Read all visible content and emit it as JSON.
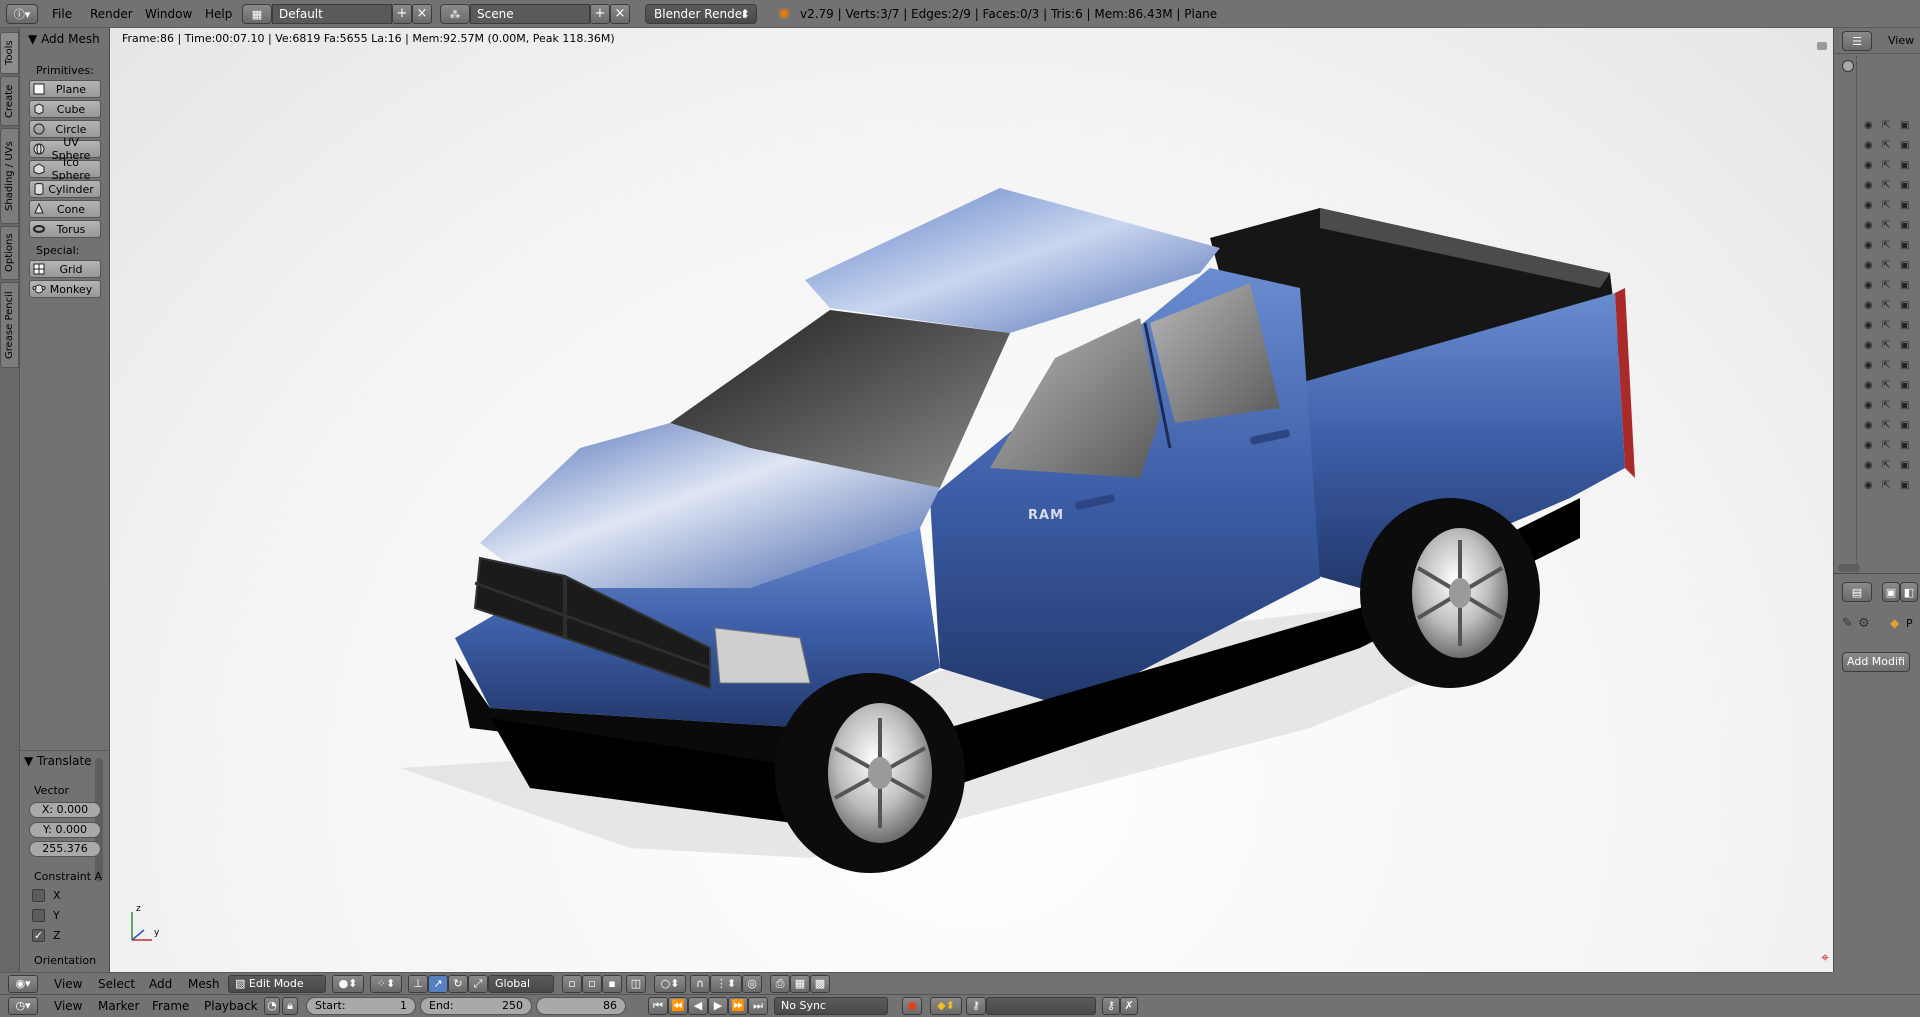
{
  "topbar": {
    "menus": [
      "File",
      "Render",
      "Window",
      "Help"
    ],
    "screen_layout": "Default",
    "scene": "Scene",
    "render_engine": "Blender Render",
    "stats": "v2.79 | Verts:3/7 | Edges:2/9 | Faces:0/3 | Tris:6 | Mem:86.43M | Plane"
  },
  "left_tabs": [
    "Tools",
    "Create",
    "Shading / UVs",
    "Options",
    "Grease Pencil"
  ],
  "tool_shelf": {
    "header": "Add Mesh",
    "primitives_label": "Primitives:",
    "primitives": [
      "Plane",
      "Cube",
      "Circle",
      "UV Sphere",
      "Ico Sphere",
      "Cylinder",
      "Cone",
      "Torus"
    ],
    "special_label": "Special:",
    "special": [
      "Grid",
      "Monkey"
    ]
  },
  "operator_panel": {
    "header": "Translate",
    "vector_label": "Vector",
    "x": "X: 0.000",
    "y": "Y: 0.000",
    "z": "255.376",
    "constraint_label": "Constraint A",
    "axes": [
      {
        "label": "X",
        "checked": false
      },
      {
        "label": "Y",
        "checked": false
      },
      {
        "label": "Z",
        "checked": true
      }
    ],
    "orientation_label": "Orientation"
  },
  "viewport": {
    "info": "Frame:86 | Time:00:07.10 | Ve:6819 Fa:5655 La:16 | Mem:92.57M (0.00M, Peak 118.36M)",
    "badge_text": "RAM",
    "axis_labels": {
      "z": "z",
      "y": "y"
    }
  },
  "outliner": {
    "view_label": "View"
  },
  "properties": {
    "add_modifier": "Add Modifi",
    "context_label": "P"
  },
  "view3d_header": {
    "menus": [
      "View",
      "Select",
      "Add",
      "Mesh"
    ],
    "mode": "Edit Mode",
    "orientation": "Global"
  },
  "timeline_header": {
    "menus": [
      "View",
      "Marker",
      "Frame",
      "Playback"
    ],
    "start_label": "Start:",
    "start_value": "1",
    "end_label": "End:",
    "end_value": "250",
    "current_frame": "86",
    "sync": "No Sync"
  },
  "colors": {
    "ui_gray": "#727272",
    "truck_blue": "#3d5fa8",
    "viewport_bg": "#ffffff"
  }
}
